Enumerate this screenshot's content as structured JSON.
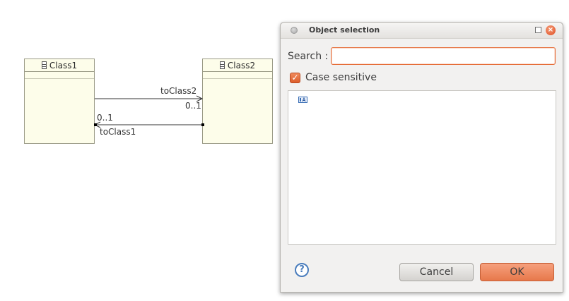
{
  "diagram": {
    "class1": {
      "name": "Class1"
    },
    "class2": {
      "name": "Class2"
    },
    "edge_to_class2": {
      "role": "toClass2",
      "multiplicity": "0..1"
    },
    "edge_to_class1": {
      "role": "toClass1",
      "multiplicity": "0..1"
    }
  },
  "dialog": {
    "title": "Object selection",
    "search_label": "Search :",
    "search_value": "",
    "case_sensitive_label": "Case sensitive",
    "case_sensitive_checked": true,
    "checkbox_mark": "✓",
    "results": [
      {
        "icon": "model-element-icon",
        "label": ""
      }
    ],
    "help_symbol": "?",
    "cancel_label": "Cancel",
    "ok_label": "OK",
    "close_symbol": "×"
  },
  "colors": {
    "accent": "#e66f3b",
    "class_fill": "#fdfdea",
    "help_blue": "#4a7dbd"
  }
}
